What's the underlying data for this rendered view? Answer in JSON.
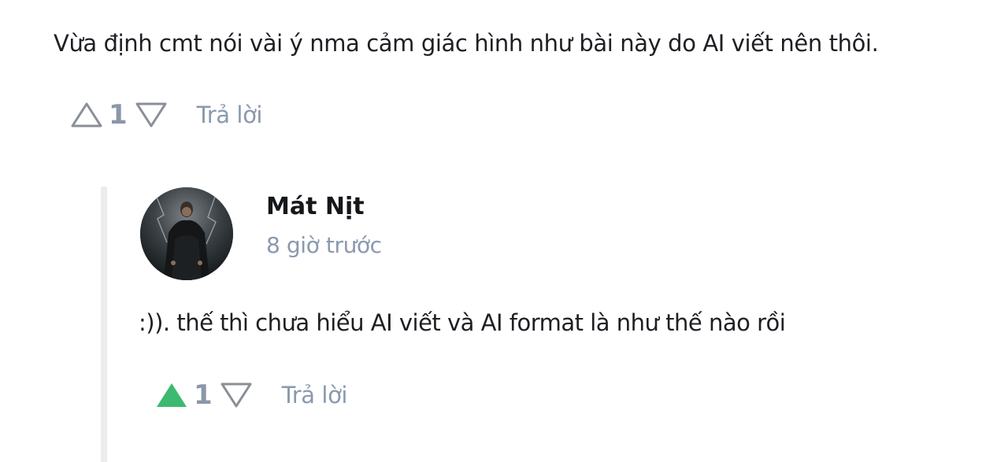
{
  "parent_comment": {
    "text": "Vừa định cmt nói vài ý nma cảm giác hình như bài này do AI viết nên thôi.",
    "vote_count": "1",
    "upvoted": false,
    "reply_label": "Trả lời"
  },
  "reply_comment": {
    "author": "Mát Nịt",
    "time": "8 giờ trước",
    "text": ":)). thế thì chưa hiểu AI viết và AI format là như thế nào rồi",
    "vote_count": "1",
    "upvoted": true,
    "reply_label": "Trả lời"
  },
  "icons": {
    "upvote": "triangle-up-icon",
    "downvote": "triangle-down-icon"
  },
  "colors": {
    "upvote_active": "#3dba6f",
    "vote_inactive": "#8a8f96",
    "muted_text": "#8a99ad",
    "thread_line": "#ececee"
  }
}
